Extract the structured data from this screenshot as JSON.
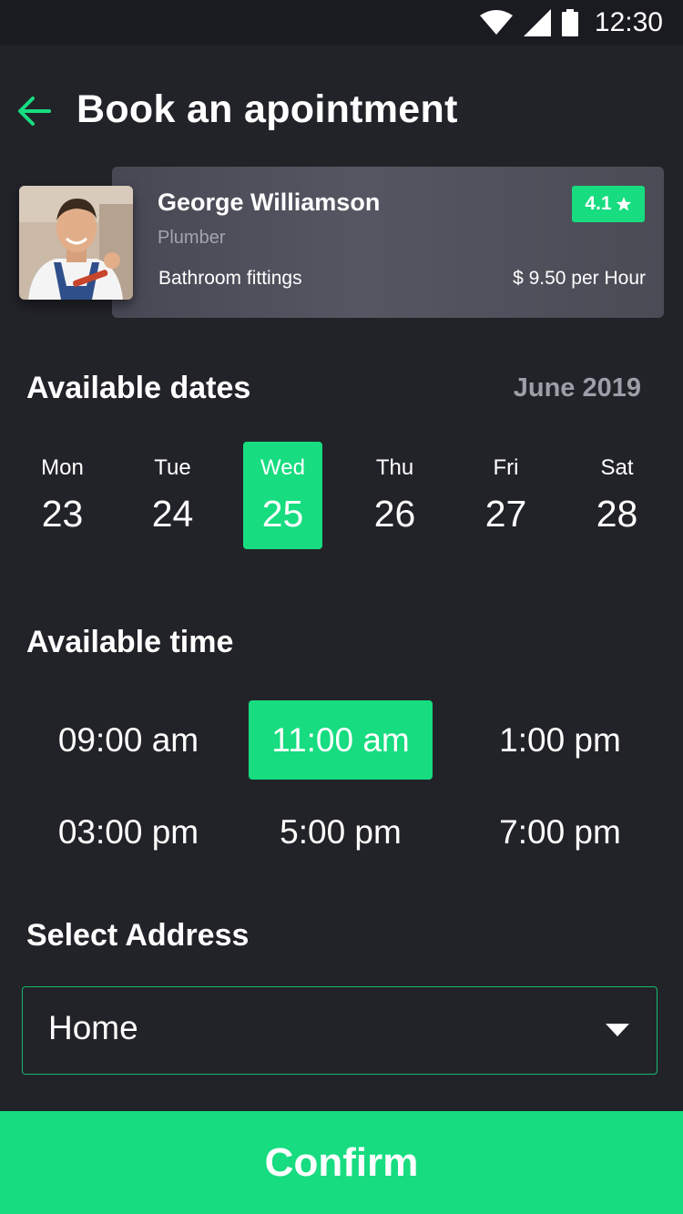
{
  "status_bar": {
    "time": "12:30",
    "icons": [
      "wifi-icon",
      "signal-icon",
      "battery-icon"
    ]
  },
  "header": {
    "title": "Book an apointment",
    "back_icon": "arrow-left-icon"
  },
  "worker": {
    "name": "George Williamson",
    "role": "Plumber",
    "skill": "Bathroom fittings",
    "price": "$ 9.50 per Hour",
    "rating": "4.1",
    "rating_icon": "star-icon"
  },
  "dates": {
    "title": "Available dates",
    "month": "June 2019",
    "selected_index": 2,
    "items": [
      {
        "day": "Mon",
        "num": "23"
      },
      {
        "day": "Tue",
        "num": "24"
      },
      {
        "day": "Wed",
        "num": "25"
      },
      {
        "day": "Thu",
        "num": "26"
      },
      {
        "day": "Fri",
        "num": "27"
      },
      {
        "day": "Sat",
        "num": "28"
      }
    ]
  },
  "times": {
    "title": "Available time",
    "selected_index": 1,
    "slots": [
      "09:00 am",
      "11:00 am",
      "1:00 pm",
      "03:00 pm",
      "5:00 pm",
      "7:00 pm"
    ]
  },
  "address": {
    "title": "Select Address",
    "value": "Home"
  },
  "confirm": {
    "label": "Confirm"
  },
  "colors": {
    "accent": "#17dc80",
    "background": "#222329",
    "card": "#4e4f5a",
    "muted": "#9d9ea8"
  }
}
